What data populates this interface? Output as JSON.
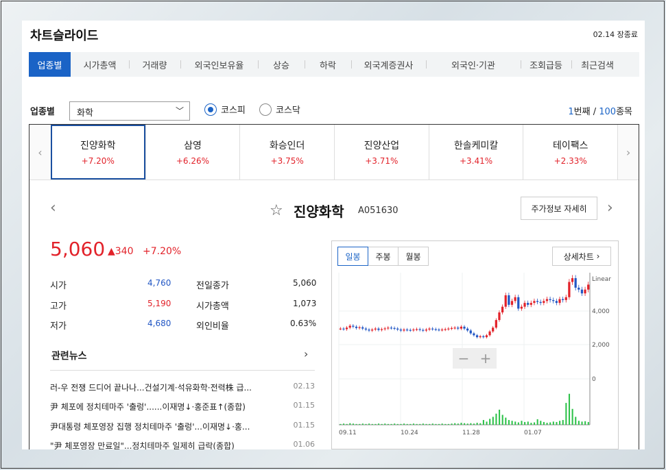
{
  "header": {
    "title": "차트슬라이드",
    "status": "02.14 장종료"
  },
  "tabs": [
    "업종별",
    "시가총액",
    "거래량",
    "외국인보유율",
    "상승",
    "하락",
    "외국계증권사",
    "외국인·기관",
    "조회급등",
    "최근검색"
  ],
  "filter": {
    "label": "업종별",
    "selected": "화학",
    "radios": [
      {
        "label": "코스피",
        "checked": true
      },
      {
        "label": "코스닥",
        "checked": false
      }
    ],
    "count_current": "1",
    "count_mid": "번째 / ",
    "count_total": "100",
    "count_suffix": "종목"
  },
  "carousel": [
    {
      "name": "진양화학",
      "change": "+7.20%"
    },
    {
      "name": "삼영",
      "change": "+6.26%"
    },
    {
      "name": "화승인더",
      "change": "+3.75%"
    },
    {
      "name": "진양산업",
      "change": "+3.71%"
    },
    {
      "name": "한솔케미칼",
      "change": "+3.41%"
    },
    {
      "name": "테이팩스",
      "change": "+2.33%"
    }
  ],
  "stock": {
    "name": "진양화학",
    "code": "A051630",
    "detail_button": "주가정보 자세히",
    "price": "5,060",
    "change": "▲340",
    "change_pct": "+7.20%",
    "stats_left": [
      {
        "label": "시가",
        "value": "4,760",
        "color": "#2156c4"
      },
      {
        "label": "고가",
        "value": "5,190",
        "color": "#e2222a"
      },
      {
        "label": "저가",
        "value": "4,680",
        "color": "#2156c4"
      }
    ],
    "stats_right": [
      {
        "label": "전일종가",
        "value": "5,060"
      },
      {
        "label": "시가총액",
        "value": "1,073"
      },
      {
        "label": "외인비율",
        "value": "0.63%"
      }
    ]
  },
  "news": {
    "title": "관련뉴스",
    "items": [
      {
        "text": "러-우 전쟁 드디어 끝나나...건설기계·석유화학·전력株 급...",
        "date": "02.13"
      },
      {
        "text": "尹 체포에 정치테마주 '출렁'......이재명↓·홍준표↑(종합)",
        "date": "01.15"
      },
      {
        "text": "尹대통령 체포영장 집행 정치테마주 '출렁'...이재명↓·홍...",
        "date": "01.15"
      },
      {
        "text": "\"尹 체포영장 만료일\"...정치테마주 일제히 급락(종합)",
        "date": "01.06"
      }
    ]
  },
  "chart": {
    "tabs": [
      {
        "label": "일봉",
        "active": true
      },
      {
        "label": "주봉",
        "active": false
      },
      {
        "label": "월봉",
        "active": false
      }
    ],
    "detail_button": "상세차트",
    "scale_label": "Linear",
    "zoom_minus": "−",
    "zoom_plus": "+"
  },
  "chart_data": {
    "type": "candlestick",
    "x_ticks": [
      "09.11",
      "10.24",
      "11.28",
      "01.07"
    ],
    "y_ticks": [
      "4,000",
      "2,000",
      "0"
    ],
    "y_scale": "Linear",
    "price_path": [
      2750,
      2720,
      2800,
      2900,
      2850,
      2780,
      2820,
      2750,
      2700,
      2650,
      2700,
      2750,
      2680,
      2720,
      2760,
      2800,
      2780,
      2750,
      2700,
      2650,
      2700,
      2680,
      2660,
      2700,
      2720,
      2680,
      2650,
      2700,
      2750,
      2720,
      2700,
      2680,
      2700,
      2720,
      2750,
      2780,
      2800,
      2750,
      2850,
      2750,
      2650,
      2500,
      2400,
      2300,
      2350,
      2300,
      2400,
      2600,
      2800,
      3200,
      3600,
      3900,
      4500,
      4000,
      4200,
      4400,
      3800,
      3900,
      4100,
      4000,
      4100,
      4200,
      4150,
      4100,
      4200,
      4300,
      4250,
      4200,
      4100,
      4300,
      4250,
      4400,
      5200,
      5400,
      4900,
      4800,
      4600,
      4800,
      5060
    ],
    "volume_path": [
      0.02,
      0.03,
      0.02,
      0.04,
      0.03,
      0.02,
      0.02,
      0.03,
      0.02,
      0.03,
      0.02,
      0.02,
      0.03,
      0.02,
      0.03,
      0.02,
      0.02,
      0.03,
      0.02,
      0.02,
      0.03,
      0.02,
      0.02,
      0.03,
      0.02,
      0.02,
      0.03,
      0.02,
      0.02,
      0.03,
      0.02,
      0.02,
      0.03,
      0.02,
      0.02,
      0.03,
      0.04,
      0.03,
      0.05,
      0.04,
      0.03,
      0.04,
      0.03,
      0.05,
      0.04,
      0.12,
      0.08,
      0.15,
      0.2,
      0.28,
      0.38,
      0.25,
      0.18,
      0.12,
      0.1,
      0.08,
      0.06,
      0.1,
      0.07,
      0.08,
      0.05,
      0.06,
      0.14,
      0.1,
      0.07,
      0.05,
      0.06,
      0.08,
      0.07,
      0.1,
      0.12,
      0.55,
      0.78,
      0.4,
      0.2,
      0.1,
      0.08,
      0.09,
      0.07
    ]
  }
}
